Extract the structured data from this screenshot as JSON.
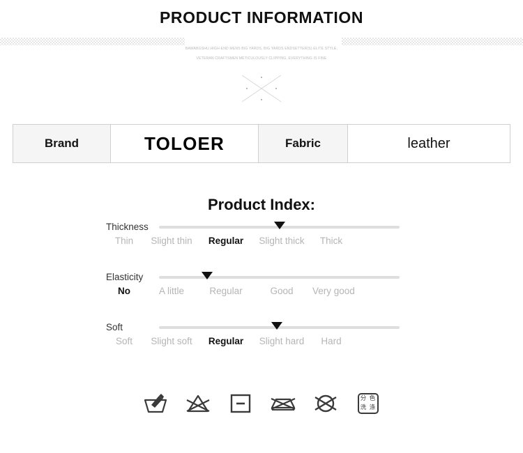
{
  "header": {
    "title": "PRODUCT INFORMATION",
    "subtitle_line1": "BAWABGSHU HIGH-END MENS BIG YARDS, BIG YARDS ENDSETTER(S) ELITE STYLE,",
    "subtitle_line2": "VETERAN CRAFTSMEN METICULOUSLY CLIPPING, EVERYTHING IS FINE",
    "ornament": "x-cross-ornament"
  },
  "spec_table": {
    "brand_label": "Brand",
    "brand_value": "TOLOER",
    "fabric_label": "Fabric",
    "fabric_value": "leather"
  },
  "product_index": {
    "title": "Product Index:",
    "rows": [
      {
        "name": "Thickness",
        "options": [
          "Thin",
          "Slight thin",
          "Regular",
          "Slight thick",
          "Thick"
        ],
        "selected_index": 2,
        "marker_percent": 50
      },
      {
        "name": "Elasticity",
        "options": [
          "No",
          "A little",
          "Regular",
          "Good",
          "Very good"
        ],
        "selected_index": 0,
        "marker_percent": 20
      },
      {
        "name": "Soft",
        "options": [
          "Soft",
          "Slight soft",
          "Regular",
          "Slight hard",
          "Hard"
        ],
        "selected_index": 2,
        "marker_percent": 49
      }
    ]
  },
  "care_icons": [
    {
      "name": "hand-wash-icon",
      "title": "Hand wash"
    },
    {
      "name": "do-not-bleach-icon",
      "title": "Do not bleach"
    },
    {
      "name": "tumble-dry-low-icon",
      "title": "Tumble dry low"
    },
    {
      "name": "do-not-iron-icon",
      "title": "Do not iron"
    },
    {
      "name": "do-not-dry-clean-icon",
      "title": "Do not dry clean"
    },
    {
      "name": "wash-separately-by-color-icon",
      "title": "分色洗涤",
      "chars": [
        "分",
        "色",
        "洗",
        "涤"
      ]
    }
  ],
  "colors": {
    "text_dark": "#111111",
    "text_muted": "#b5b5b5",
    "track": "#dedede",
    "cell_label_bg": "#f5f5f5",
    "border": "#cfcfcf"
  }
}
